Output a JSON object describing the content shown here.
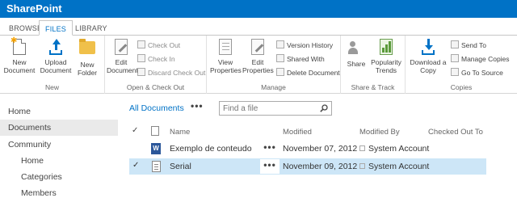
{
  "suitebar": {
    "brand": "SharePoint"
  },
  "tabs": [
    {
      "label": "BROWSE"
    },
    {
      "label": "FILES"
    },
    {
      "label": "LIBRARY"
    }
  ],
  "ribbon": {
    "new_group": {
      "label": "New",
      "new_document": "New\nDocument",
      "upload_document": "Upload\nDocument",
      "new_folder": "New\nFolder"
    },
    "open_group": {
      "label": "Open & Check Out",
      "edit_document": "Edit\nDocument",
      "check_out": "Check Out",
      "check_in": "Check In",
      "discard_check_out": "Discard Check Out"
    },
    "manage_group": {
      "label": "Manage",
      "view_properties": "View\nProperties",
      "edit_properties": "Edit\nProperties",
      "version_history": "Version History",
      "shared_with": "Shared With",
      "delete_document": "Delete Document"
    },
    "share_group": {
      "label": "Share & Track",
      "share": "Share",
      "popularity_trends": "Popularity\nTrends"
    },
    "copies_group": {
      "label": "Copies",
      "download_copy": "Download a\nCopy",
      "send_to": "Send To",
      "manage_copies": "Manage Copies",
      "go_to_source": "Go To Source"
    }
  },
  "leftnav": {
    "items": [
      {
        "label": "Home"
      },
      {
        "label": "Documents"
      },
      {
        "label": "Community"
      },
      {
        "label": "Home"
      },
      {
        "label": "Categories"
      },
      {
        "label": "Members"
      }
    ]
  },
  "main": {
    "view_label": "All Documents",
    "view_menu": "•••",
    "search_placeholder": "Find a file",
    "columns": {
      "name": "Name",
      "modified": "Modified",
      "modified_by": "Modified By",
      "checked_out_to": "Checked Out To"
    },
    "rows": [
      {
        "name": "Exemplo de conteudo",
        "modified": "November 07, 2012",
        "modified_by": "System Account",
        "selected": false,
        "file_type": "word-document-icon"
      },
      {
        "name": "Serial",
        "modified": "November 09, 2012",
        "modified_by": "System Account",
        "selected": true,
        "file_type": "text-file-icon"
      }
    ],
    "row_menu": "•••"
  },
  "colors": {
    "accent": "#0072c6",
    "selected_row": "#cde6f7",
    "nav_selected": "#eaeaea"
  }
}
